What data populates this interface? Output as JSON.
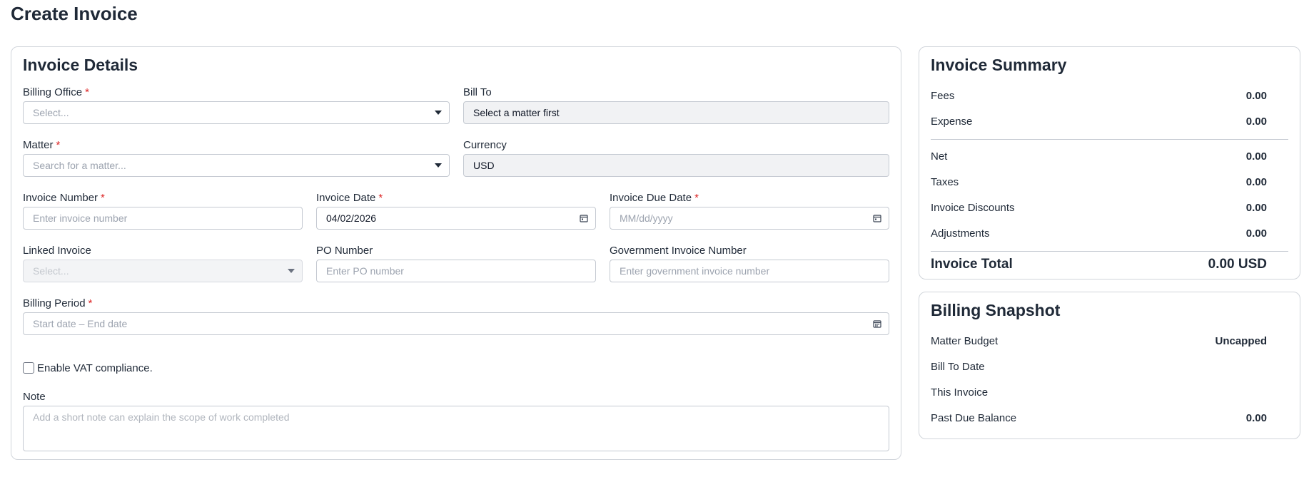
{
  "page": {
    "title": "Create Invoice"
  },
  "details": {
    "title": "Invoice Details",
    "billing_office": {
      "label": "Billing Office",
      "placeholder": "Select..."
    },
    "bill_to": {
      "label": "Bill To",
      "value": "Select a matter first"
    },
    "matter": {
      "label": "Matter",
      "placeholder": "Search for a matter..."
    },
    "currency": {
      "label": "Currency",
      "value": "USD"
    },
    "invoice_number": {
      "label": "Invoice Number",
      "placeholder": "Enter invoice number"
    },
    "invoice_date": {
      "label": "Invoice Date",
      "value": "04/02/2026"
    },
    "invoice_due_date": {
      "label": "Invoice Due Date",
      "placeholder": "MM/dd/yyyy"
    },
    "linked_invoice": {
      "label": "Linked Invoice",
      "placeholder": "Select..."
    },
    "po_number": {
      "label": "PO Number",
      "placeholder": "Enter PO number"
    },
    "gov_invoice_number": {
      "label": "Government Invoice Number",
      "placeholder": "Enter government invoice number"
    },
    "billing_period": {
      "label": "Billing Period",
      "placeholder": "Start date – End date"
    },
    "vat": {
      "label": "Enable VAT compliance.",
      "checked": false
    },
    "note": {
      "label": "Note",
      "placeholder": "Add a short note can explain the scope of work completed"
    },
    "required_mark": "*"
  },
  "summary": {
    "title": "Invoice Summary",
    "fees": {
      "label": "Fees",
      "value": "0.00"
    },
    "expense": {
      "label": "Expense",
      "value": "0.00"
    },
    "net": {
      "label": "Net",
      "value": "0.00"
    },
    "taxes": {
      "label": "Taxes",
      "value": "0.00"
    },
    "discounts": {
      "label": "Invoice Discounts",
      "value": "0.00"
    },
    "adjustments": {
      "label": "Adjustments",
      "value": "0.00"
    },
    "total": {
      "label": "Invoice Total",
      "value": "0.00 USD"
    }
  },
  "snapshot": {
    "title": "Billing Snapshot",
    "matter_budget": {
      "label": "Matter Budget",
      "value": "Uncapped"
    },
    "bill_to_date": {
      "label": "Bill To Date",
      "value": ""
    },
    "this_invoice": {
      "label": "This Invoice",
      "value": ""
    },
    "past_due": {
      "label": "Past Due Balance",
      "value": "0.00"
    }
  },
  "colors": {
    "required": "#dc2626",
    "border": "#c4c9d1",
    "readonly_bg": "#f1f2f4"
  }
}
